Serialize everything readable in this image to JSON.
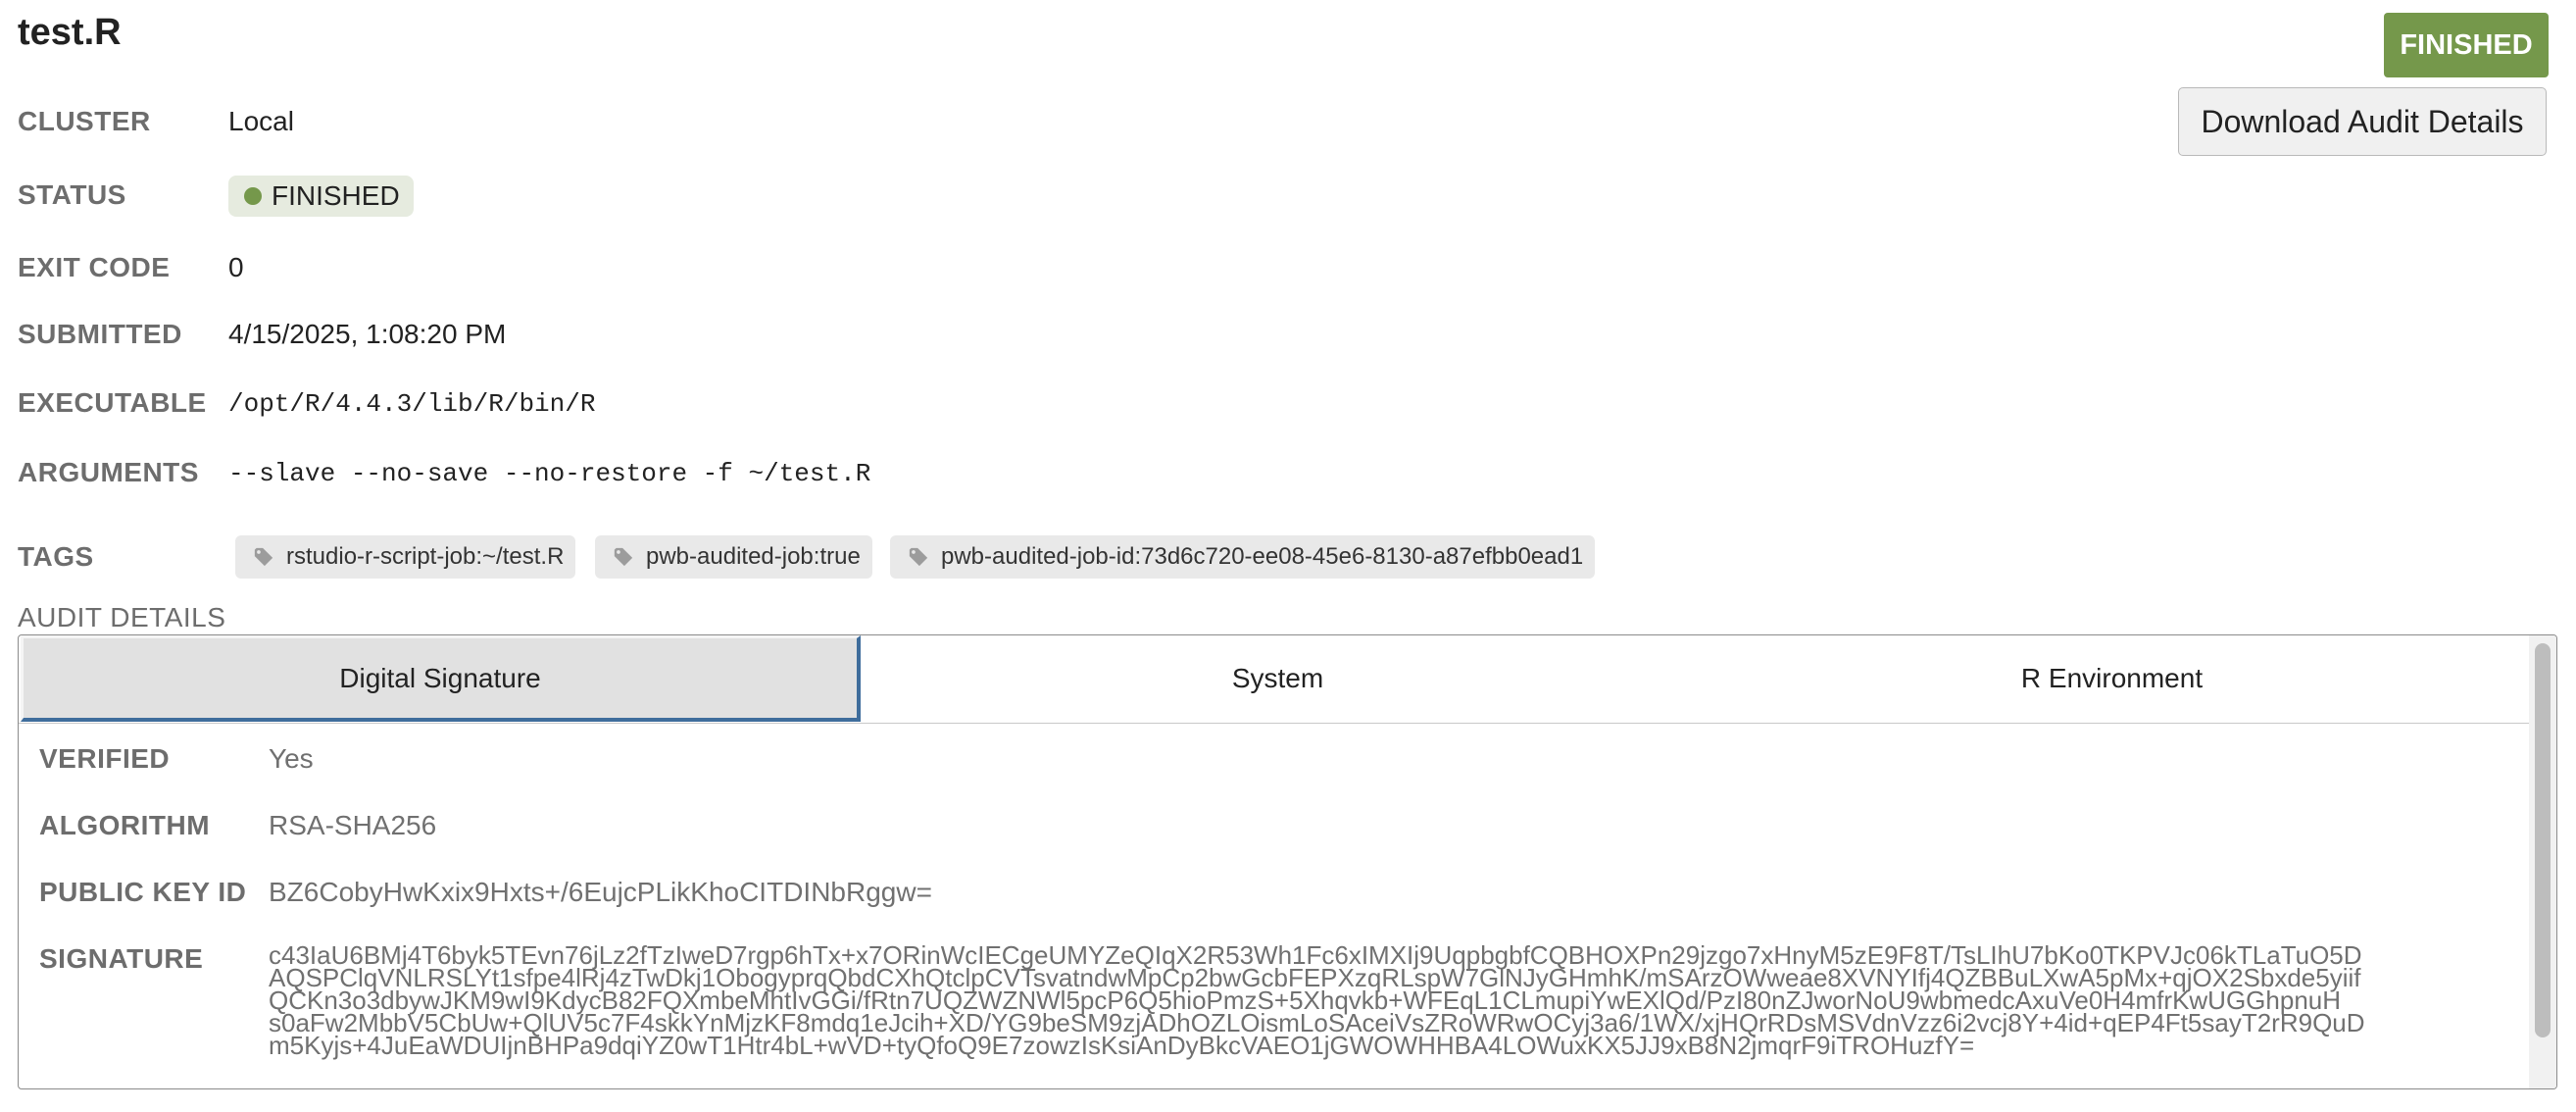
{
  "job": {
    "title": "test.R",
    "status_badge": "FINISHED",
    "download_label": "Download Audit Details"
  },
  "details": {
    "cluster_label": "CLUSTER",
    "cluster_value": "Local",
    "status_label": "STATUS",
    "status_value": "FINISHED",
    "exit_code_label": "EXIT CODE",
    "exit_code_value": "0",
    "submitted_label": "SUBMITTED",
    "submitted_value": "4/15/2025, 1:08:20 PM",
    "executable_label": "EXECUTABLE",
    "executable_value": "/opt/R/4.4.3/lib/R/bin/R",
    "arguments_label": "ARGUMENTS",
    "arguments_value": "--slave --no-save --no-restore -f ~/test.R",
    "tags_label": "TAGS",
    "tags": [
      "rstudio-r-script-job:~/test.R",
      "pwb-audited-job:true",
      "pwb-audited-job-id:73d6c720-ee08-45e6-8130-a87efbb0ead1"
    ]
  },
  "audit": {
    "heading": "AUDIT DETAILS",
    "tabs": [
      "Digital Signature",
      "System",
      "R Environment"
    ],
    "active_tab": "Digital Signature",
    "verified_label": "VERIFIED",
    "verified_value": "Yes",
    "algorithm_label": "ALGORITHM",
    "algorithm_value": "RSA-SHA256",
    "public_key_label": "PUBLIC KEY ID",
    "public_key_value": "BZ6CobyHwKxix9Hxts+/6EujcPLikKhoCITDINbRggw=",
    "signature_label": "SIGNATURE",
    "signature_lines": [
      "c43IaU6BMj4T6byk5TEvn76jLz2fTzIweD7rgp6hTx+x7ORinWcIECgeUMYZeQIqX2R53Wh1Fc6xIMXIj9UqpbgbfCQBHOXPn29jzgo7xHnyM5zE9F8T/TsLIhU7bKo0TKPVJc06kTLaTuO5D",
      "AQSPClqVNLRSLYt1sfpe4lRj4zTwDkj1ObogyprqQbdCXhQtclpCVTsvatndwMpCp2bwGcbFEPXzqRLspW7GlNJyGHmhK/mSArzOWweae8XVNYIfj4QZBBuLXwA5pMx+qjOX2Sbxde5yiif",
      "QCKn3o3dbywJKM9wI9KdycB82FQXmbeMhtIvGGi/fRtn7UQZWZNWl5pcP6Q5hioPmzS+5Xhqvkb+WFEqL1CLmupiYwEXlQd/PzI80nZJworNoU9wbmedcAxuVe0H4mfrKwUGGhpnuH",
      "s0aFw2MbbV5CbUw+QlUV5c7F4skkYnMjzKF8mdq1eJcih+XD/YG9beSM9zjADhOZLOismLoSAceiVsZRoWRwOCyj3a6/1WX/xjHQrRDsMSVdnVzz6i2vcj8Y+4id+qEP4Ft5sayT2rR9QuD",
      "m5Kyjs+4JuEaWDUIjnBHPa9dqiYZ0wT1Htr4bL+wVD+tyQfoQ9E7zowzIsKsiAnDyBkcVAEO1jGWOWHHBA4LOWuxKX5JJ9xB8N2jmqrF9iTROHuzfY="
    ]
  }
}
